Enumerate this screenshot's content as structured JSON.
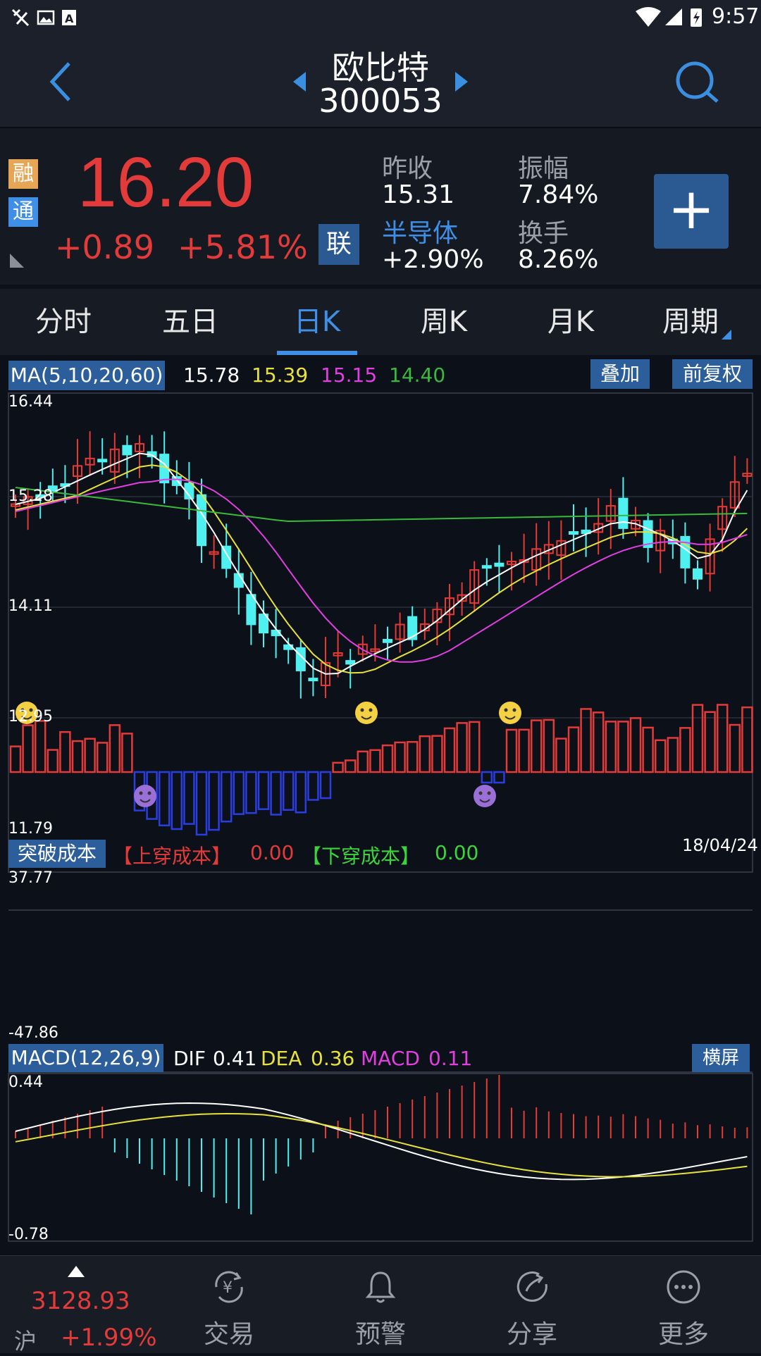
{
  "status": {
    "time": "9:57"
  },
  "header": {
    "stock_name": "欧比特",
    "stock_code": "300053"
  },
  "quote": {
    "badge_rong": "融",
    "badge_tong": "通",
    "price": "16.20",
    "change": "+0.89",
    "change_pct": "+5.81%",
    "lian_label": "联",
    "prev_close_label": "昨收",
    "prev_close": "15.31",
    "amplitude_label": "振幅",
    "amplitude": "7.84%",
    "sector_label": "半导体",
    "sector_change": "+2.90%",
    "turnover_label": "换手",
    "turnover": "8.26%",
    "add_label": "+"
  },
  "tabs": [
    {
      "label": "分时"
    },
    {
      "label": "五日"
    },
    {
      "label": "日K"
    },
    {
      "label": "周K"
    },
    {
      "label": "月K"
    },
    {
      "label": "周期"
    }
  ],
  "kline": {
    "ma_label": "MA(5,10,20,60)",
    "ma5": "15.78",
    "ma10": "15.39",
    "ma20": "15.15",
    "ma60": "14.40",
    "overlay_button": "叠加",
    "adjust_button": "前复权",
    "y_ticks": [
      "16.44",
      "15.28",
      "14.11",
      "12.95",
      "11.79"
    ],
    "colors": {
      "up": "#e53935",
      "down": "#4ff0f0",
      "ma5": "#ffffff",
      "ma10": "#e8e13a",
      "ma20": "#e23ee2",
      "ma60": "#39b93d"
    }
  },
  "breakout": {
    "label": "突破成本",
    "up_cross_label": "【上穿成本】",
    "up_cross_value": "0.00",
    "down_cross_label": "【下穿成本】",
    "down_cross_value": "0.00",
    "date": "18/04/24",
    "y_top": "37.77",
    "y_bottom": "-47.86"
  },
  "macd": {
    "label": "MACD(12,26,9)",
    "dif_label": "DIF",
    "dif": "0.41",
    "dea_label": "DEA",
    "dea": "0.36",
    "macd_label": "MACD",
    "macd": "0.11",
    "landscape_button": "横屏",
    "y_top": "0.44",
    "y_bottom": "-0.78"
  },
  "bottom_nav": {
    "index_value": "3128.93",
    "index_name": "沪",
    "index_change": "+1.99%",
    "items": [
      {
        "label": "交易"
      },
      {
        "label": "预警"
      },
      {
        "label": "分享"
      },
      {
        "label": "更多"
      }
    ]
  }
}
